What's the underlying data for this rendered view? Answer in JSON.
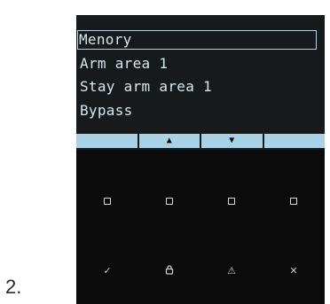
{
  "step_label": "2.",
  "lcd": {
    "menu_items": [
      {
        "label": "Menory",
        "selected": true
      },
      {
        "label": "Arm area 1",
        "selected": false
      },
      {
        "label": "Stay arm area 1",
        "selected": false
      },
      {
        "label": "Bypass",
        "selected": false
      }
    ],
    "softkeys": [
      {
        "label": "",
        "icon": ""
      },
      {
        "label": "▲",
        "icon": "arrow-up-icon"
      },
      {
        "label": "▼",
        "icon": "arrow-down-icon"
      },
      {
        "label": "",
        "icon": ""
      }
    ]
  },
  "keypad": {
    "square_buttons": [
      "square-button-1",
      "square-button-2",
      "square-button-3",
      "square-button-4"
    ],
    "bottom_icons": [
      {
        "icon": "check-icon",
        "glyph": "✓"
      },
      {
        "icon": "lock-icon",
        "glyph": "🔒"
      },
      {
        "icon": "warning-icon",
        "glyph": "⚠"
      },
      {
        "icon": "close-icon",
        "glyph": "✕"
      }
    ]
  },
  "colors": {
    "lcd_text": "#d6e6ef",
    "softkey_bg": "#a9d2e6",
    "device_bg": "#0b0b0b"
  }
}
